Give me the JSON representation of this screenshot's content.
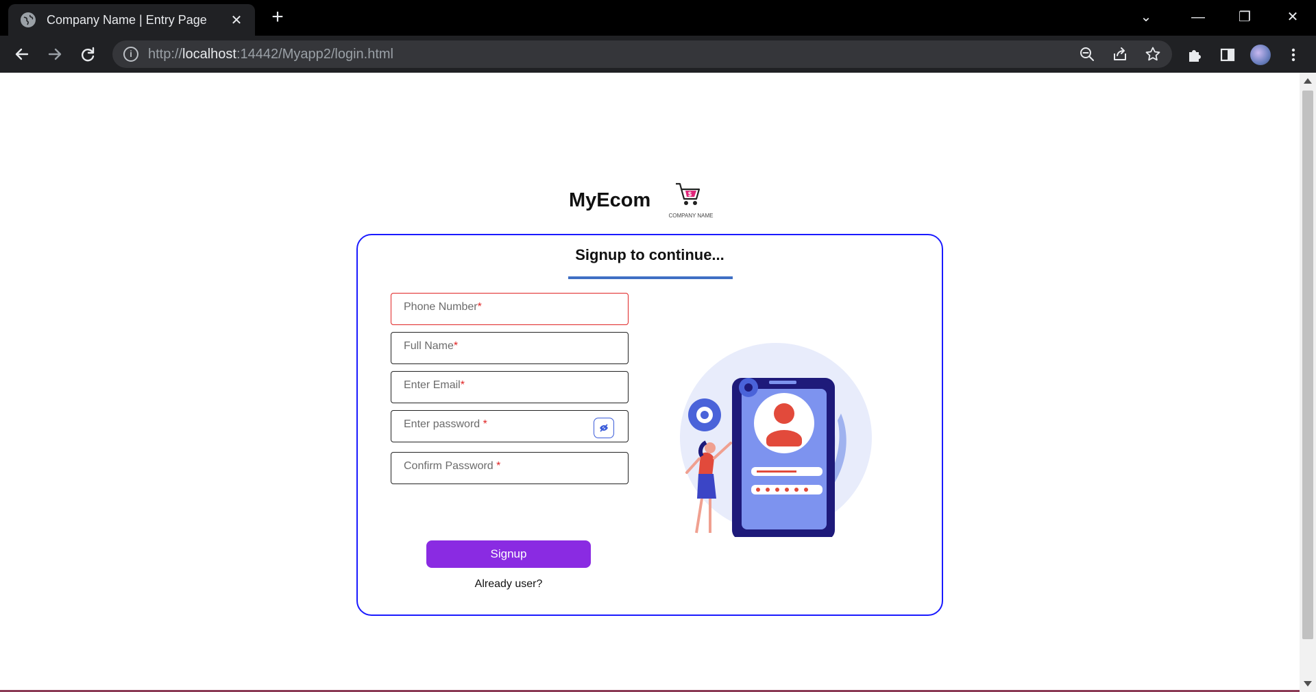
{
  "browser": {
    "tab_title": "Company Name | Entry Page",
    "tab_close": "✕",
    "new_tab": "+",
    "url_scheme": "http://",
    "url_host": "localhost",
    "url_rest": ":14442/Myapp2/login.html",
    "window_controls": {
      "dropdown": "⌄",
      "minimize": "—",
      "restore": "❐",
      "close": "✕"
    },
    "icons": [
      "back-arrow-icon",
      "forward-arrow-icon",
      "reload-icon",
      "site-info-icon",
      "zoom-out-icon",
      "share-icon",
      "bookmark-star-icon",
      "extensions-puzzle-icon",
      "side-panel-icon",
      "profile-avatar-icon",
      "menu-kebab-icon"
    ]
  },
  "brand": {
    "name": "MyEcom",
    "logo_caption": "COMPANY NAME"
  },
  "signup": {
    "title": "Signup to continue...",
    "fields": {
      "phone": {
        "label": "Phone Number",
        "required_mark": "*"
      },
      "full_name": {
        "label": "Full Name",
        "required_mark": "*"
      },
      "email": {
        "label": "Enter Email",
        "required_mark": "*"
      },
      "password": {
        "label": "Enter password ",
        "required_mark": "*"
      },
      "confirm_password": {
        "label": "Confirm Password ",
        "required_mark": "*"
      }
    },
    "submit_label": "Signup",
    "already_user": "Already user?"
  },
  "colors": {
    "card_border": "#1a1aff",
    "title_underline": "#3f6fc4",
    "error_border": "#e02424",
    "button_bg": "#8a2be2"
  }
}
